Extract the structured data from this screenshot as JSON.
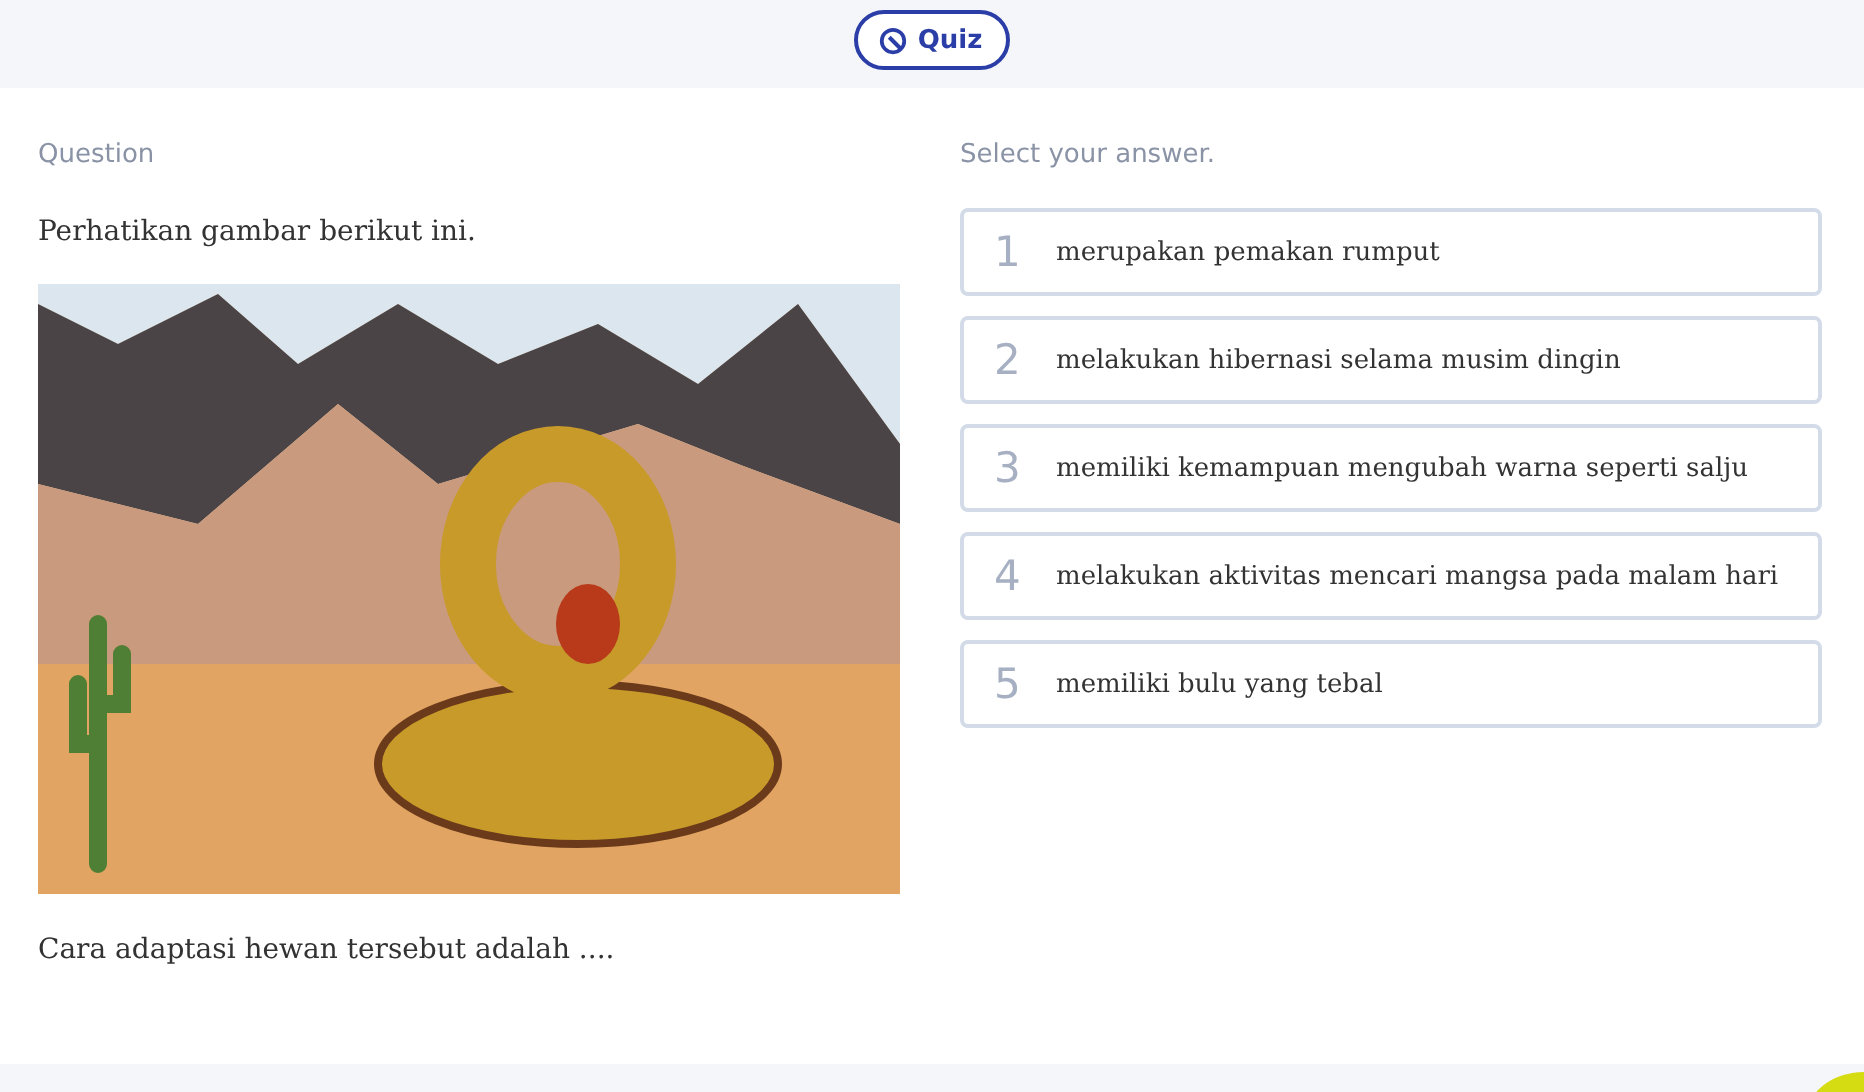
{
  "header": {
    "quiz_button": "Quiz"
  },
  "question": {
    "label": "Question",
    "intro": "Perhatikan gambar berikut ini.",
    "prompt": "Cara adaptasi hewan tersebut adalah ...."
  },
  "answers": {
    "label": "Select your answer.",
    "options": [
      {
        "number": "1",
        "text": "merupakan pemakan rumput",
        "selected": false
      },
      {
        "number": "2",
        "text": "melakukan hibernasi selama musim dingin",
        "selected": false
      },
      {
        "number": "3",
        "text": "memiliki kemampuan mengubah warna seperti salju",
        "selected": false
      },
      {
        "number": "4",
        "text": "melakukan aktivitas mencari mangsa pada malam hari",
        "selected": false
      },
      {
        "number": "5",
        "text": "memiliki bulu yang tebal",
        "selected": false
      }
    ]
  }
}
